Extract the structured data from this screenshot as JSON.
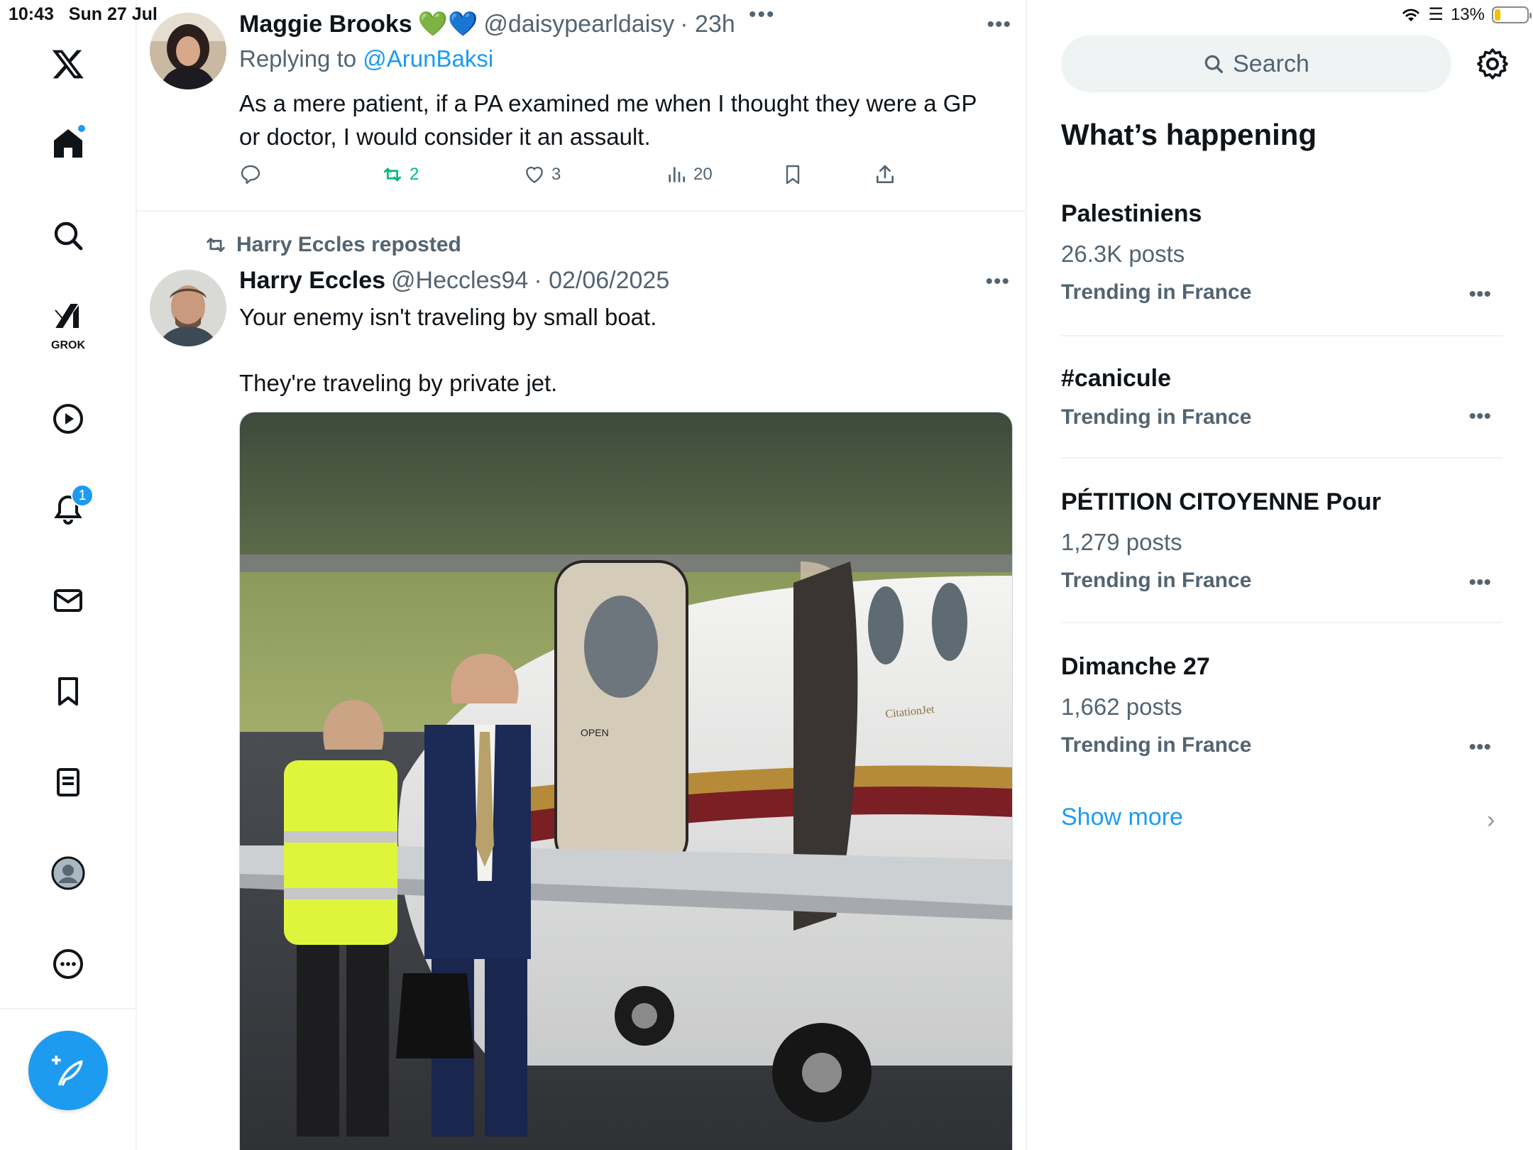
{
  "status_bar": {
    "time": "10:43",
    "date": "Sun 27 Jul",
    "battery": "13%"
  },
  "nav": {
    "grok_label": "GROK",
    "notifications_count": "1"
  },
  "tweet1": {
    "name": "Maggie Brooks",
    "emojis": "💚💙",
    "handle": "@daisypearldaisy",
    "time": "· 23h",
    "replying_prefix": "Replying to",
    "replying_to": "@ArunBaksi",
    "text_line1": "As a mere patient, if a PA examined me when I thought they were a GP",
    "text_line2": "or doctor, I would consider it an assault.",
    "retweets": "2",
    "likes": "3",
    "views": "20"
  },
  "tweet2": {
    "reposted_by": "Harry Eccles reposted",
    "name": "Harry Eccles",
    "handle": "@Heccles94",
    "date": "· 02/06/2025",
    "text_line1": "Your enemy isn't traveling by small boat.",
    "text_line2": "They're traveling by private jet.",
    "image_door_label": "OPEN",
    "image_plane_label": "CitationJet"
  },
  "sidebar": {
    "search_placeholder": "Search",
    "title": "What’s happening",
    "trends": [
      {
        "name": "Palestiniens",
        "count": "26.3K posts",
        "context": "Trending in France"
      },
      {
        "name": "#canicule",
        "count": "",
        "context": "Trending in France"
      },
      {
        "name": "PÉTITION CITOYENNE Pour",
        "count": "1,279 posts",
        "context": "Trending in France"
      },
      {
        "name": "Dimanche 27",
        "count": "1,662 posts",
        "context": "Trending in France"
      }
    ],
    "show_more": "Show more"
  },
  "colors": {
    "accent": "#1d9bf0",
    "muted": "#536471",
    "retweet": "#00ba7c",
    "divider": "#eff3f4"
  }
}
